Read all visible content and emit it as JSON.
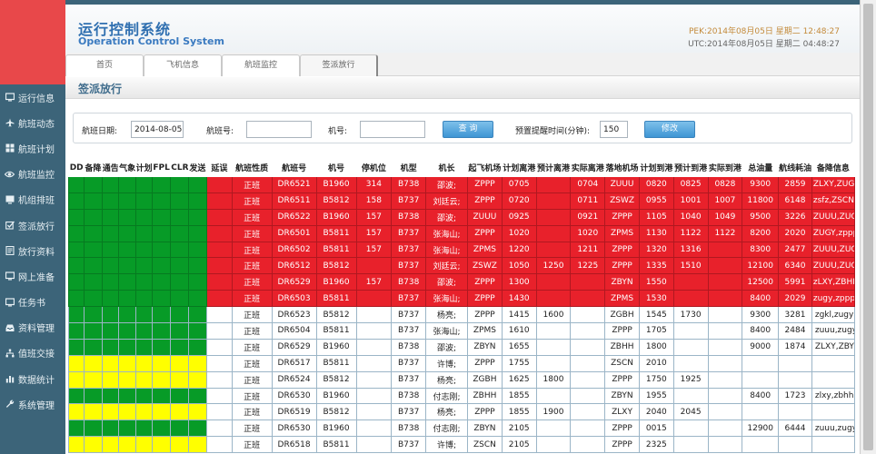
{
  "header": {
    "title": "运行控制系统",
    "subtitle": "Operation Control System",
    "pek_time": "PEK:2014年08月05日 星期二 12:48:27",
    "utc_time": "UTC:2014年08月05日 星期二 04:48:27"
  },
  "tabs": [
    "首页",
    "飞机信息",
    "航班监控",
    "签派放行"
  ],
  "page_title": "签派放行",
  "sidebar": [
    {
      "label": "运行信息",
      "icon": "screen-icon"
    },
    {
      "label": "航班动态",
      "icon": "plane-icon"
    },
    {
      "label": "航班计划",
      "icon": "grid-icon"
    },
    {
      "label": "航班监控",
      "icon": "eye-icon"
    },
    {
      "label": "机组排班",
      "icon": "monitor-icon"
    },
    {
      "label": "签派放行",
      "icon": "checkbox-icon"
    },
    {
      "label": "放行资料",
      "icon": "document-icon"
    },
    {
      "label": "网上准备",
      "icon": "screen-icon"
    },
    {
      "label": "任务书",
      "icon": "screen-icon"
    },
    {
      "label": "资料管理",
      "icon": "inbox-icon"
    },
    {
      "label": "值班交接",
      "icon": "sitemap-icon"
    },
    {
      "label": "数据统计",
      "icon": "chart-icon"
    },
    {
      "label": "系统管理",
      "icon": "wrench-icon"
    }
  ],
  "filter": {
    "date_label": "航班日期:",
    "date_value": "2014-08-05",
    "flight_label": "航班号:",
    "flight_value": "",
    "reg_label": "机号:",
    "reg_value": "",
    "query_button": "查 询",
    "reminder_label": "预置提醒时间(分钟):",
    "reminder_value": "150",
    "modify_button": "修改"
  },
  "table": {
    "columns": [
      "DD",
      "备降",
      "通告",
      "气象",
      "计划",
      "FPL",
      "CLR",
      "发送",
      "延误",
      "航班性质",
      "航班号",
      "机号",
      "停机位",
      "机型",
      "机长",
      "起飞机场",
      "计划离港",
      "预计离港",
      "实际离港",
      "落地机场",
      "计划到港",
      "预计到港",
      "实际到港",
      "总油量",
      "航线耗油",
      "备降信息"
    ],
    "rows": [
      {
        "status": "red",
        "flags": [
          "g",
          "g",
          "g",
          "g",
          "g",
          "g",
          "g",
          "g"
        ],
        "cells": [
          "",
          "正班",
          "DR6521",
          "B1960",
          "314",
          "B738",
          "邵波;",
          "ZPPP",
          "0705",
          "",
          "0704",
          "ZUUU",
          "0820",
          "0825",
          "0828",
          "9300",
          "2859",
          "ZLXY,ZUGY"
        ]
      },
      {
        "status": "red",
        "flags": [
          "g",
          "g",
          "g",
          "g",
          "g",
          "g",
          "g",
          "g"
        ],
        "cells": [
          "",
          "正班",
          "DR6511",
          "B5812",
          "158",
          "B737",
          "刘廷云;",
          "ZPPP",
          "0720",
          "",
          "0711",
          "ZSWZ",
          "0955",
          "1001",
          "1007",
          "11800",
          "6148",
          "zsfz,ZSCN"
        ]
      },
      {
        "status": "red",
        "flags": [
          "g",
          "g",
          "g",
          "g",
          "g",
          "g",
          "g",
          "g"
        ],
        "cells": [
          "",
          "正班",
          "DR6522",
          "B1960",
          "157",
          "B738",
          "邵波;",
          "ZUUU",
          "0925",
          "",
          "0921",
          "ZPPP",
          "1105",
          "1040",
          "1049",
          "9500",
          "3226",
          "ZUUU,ZUGY"
        ]
      },
      {
        "status": "red",
        "flags": [
          "g",
          "g",
          "g",
          "g",
          "g",
          "g",
          "g",
          "g"
        ],
        "cells": [
          "",
          "正班",
          "DR6501",
          "B5811",
          "157",
          "B737",
          "张海山;",
          "ZPPP",
          "1020",
          "",
          "1020",
          "ZPMS",
          "1130",
          "1122",
          "1122",
          "8200",
          "2020",
          "ZUGY,zppp"
        ]
      },
      {
        "status": "red",
        "flags": [
          "g",
          "g",
          "g",
          "g",
          "g",
          "g",
          "g",
          "g"
        ],
        "cells": [
          "",
          "正班",
          "DR6502",
          "B5811",
          "157",
          "B737",
          "张海山;",
          "ZPMS",
          "1220",
          "",
          "1211",
          "ZPPP",
          "1320",
          "1316",
          "",
          "8300",
          "2477",
          "ZUUU,ZUGY"
        ]
      },
      {
        "status": "red",
        "flags": [
          "g",
          "g",
          "g",
          "g",
          "g",
          "g",
          "g",
          "g"
        ],
        "cells": [
          "",
          "正班",
          "DR6512",
          "B5812",
          "",
          "B737",
          "刘廷云;",
          "ZSWZ",
          "1050",
          "1250",
          "1225",
          "ZPPP",
          "1335",
          "1510",
          "",
          "12100",
          "6340",
          "ZUUU,ZUGY"
        ]
      },
      {
        "status": "red",
        "flags": [
          "g",
          "g",
          "g",
          "g",
          "g",
          "g",
          "g",
          "g"
        ],
        "cells": [
          "",
          "正班",
          "DR6529",
          "B1960",
          "157",
          "B738",
          "邵波;",
          "ZPPP",
          "1300",
          "",
          "",
          "ZBYN",
          "1550",
          "",
          "",
          "12500",
          "5991",
          "zLXY,ZBHH"
        ]
      },
      {
        "status": "red",
        "flags": [
          "g",
          "g",
          "g",
          "g",
          "g",
          "g",
          "g",
          "g"
        ],
        "cells": [
          "",
          "正班",
          "DR6503",
          "B5811",
          "",
          "B737",
          "张海山;",
          "ZPPP",
          "1430",
          "",
          "",
          "ZPMS",
          "1530",
          "",
          "",
          "8400",
          "2029",
          "zugy,zppp"
        ]
      },
      {
        "status": "white",
        "flags": [
          "g",
          "g",
          "g",
          "g",
          "g",
          "g",
          "g",
          "g"
        ],
        "cells": [
          "",
          "正班",
          "DR6523",
          "B5812",
          "",
          "B737",
          "杨亮;",
          "ZPPP",
          "1415",
          "1600",
          "",
          "ZGBH",
          "1545",
          "1730",
          "",
          "9300",
          "3281",
          "zgkl,zugy"
        ]
      },
      {
        "status": "white",
        "flags": [
          "g",
          "g",
          "g",
          "g",
          "g",
          "g",
          "g",
          "g"
        ],
        "cells": [
          "",
          "正班",
          "DR6504",
          "B5811",
          "",
          "B737",
          "张海山;",
          "ZPMS",
          "1610",
          "",
          "",
          "ZPPP",
          "1705",
          "",
          "",
          "8400",
          "2484",
          "zuuu,zugy"
        ]
      },
      {
        "status": "white",
        "flags": [
          "g",
          "g",
          "g",
          "g",
          "g",
          "g",
          "g",
          "g"
        ],
        "cells": [
          "",
          "正班",
          "DR6529",
          "B1960",
          "",
          "B738",
          "邵波;",
          "ZBYN",
          "1655",
          "",
          "",
          "ZBHH",
          "1800",
          "",
          "",
          "9000",
          "1874",
          "ZLXY,ZBYN"
        ]
      },
      {
        "status": "white",
        "flags": [
          "y",
          "y",
          "y",
          "y",
          "y",
          "y",
          "y",
          "y"
        ],
        "cells": [
          "",
          "正班",
          "DR6517",
          "B5811",
          "",
          "B737",
          "许博;",
          "ZPPP",
          "1755",
          "",
          "",
          "ZSCN",
          "2010",
          "",
          "",
          "",
          "",
          ""
        ]
      },
      {
        "status": "white",
        "flags": [
          "y",
          "y",
          "y",
          "y",
          "y",
          "y",
          "y",
          "y"
        ],
        "cells": [
          "",
          "正班",
          "DR6524",
          "B5812",
          "",
          "B737",
          "杨亮;",
          "ZGBH",
          "1625",
          "1800",
          "",
          "ZPPP",
          "1750",
          "1925",
          "",
          "",
          "",
          ""
        ]
      },
      {
        "status": "white",
        "flags": [
          "g",
          "g",
          "g",
          "g",
          "g",
          "g",
          "g",
          "g"
        ],
        "cells": [
          "",
          "正班",
          "DR6530",
          "B1960",
          "",
          "B738",
          "付志刚;",
          "ZBHH",
          "1855",
          "",
          "",
          "ZBYN",
          "1955",
          "",
          "",
          "8400",
          "1723",
          "zlxy,zbhh"
        ]
      },
      {
        "status": "white",
        "flags": [
          "y",
          "y",
          "y",
          "y",
          "y",
          "y",
          "y",
          "y"
        ],
        "cells": [
          "",
          "正班",
          "DR6519",
          "B5812",
          "",
          "B737",
          "杨亮;",
          "ZPPP",
          "1855",
          "1900",
          "",
          "ZLXY",
          "2040",
          "2045",
          "",
          "",
          "",
          ""
        ]
      },
      {
        "status": "white",
        "flags": [
          "g",
          "g",
          "g",
          "g",
          "g",
          "g",
          "g",
          "g"
        ],
        "cells": [
          "",
          "正班",
          "DR6530",
          "B1960",
          "",
          "B738",
          "付志刚;",
          "ZBYN",
          "2105",
          "",
          "",
          "ZPPP",
          "0015",
          "",
          "",
          "12900",
          "6444",
          "zuuu,zugy"
        ]
      },
      {
        "status": "white",
        "flags": [
          "y",
          "y",
          "y",
          "y",
          "y",
          "y",
          "y",
          "y"
        ],
        "cells": [
          "",
          "正班",
          "DR6518",
          "B5811",
          "",
          "B737",
          "许博;",
          "ZSCN",
          "2105",
          "",
          "",
          "ZPPP",
          "2325",
          "",
          "",
          "",
          "",
          ""
        ]
      }
    ]
  },
  "colors": {
    "sidebar": "#3c6479",
    "logo": "#e8484a",
    "delay_red": "#e8212b",
    "ok_green": "#079b27",
    "pending_yellow": "#ffff00",
    "title_blue": "#2f6fb0"
  }
}
